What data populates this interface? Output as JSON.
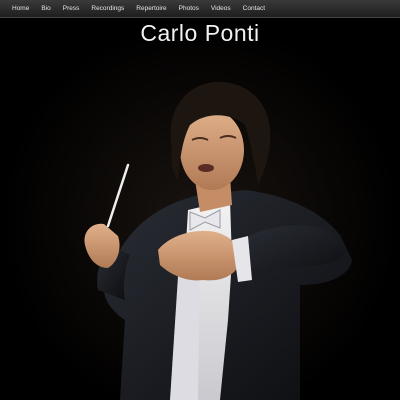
{
  "nav": {
    "items": [
      {
        "label": "Home"
      },
      {
        "label": "Bio"
      },
      {
        "label": "Press"
      },
      {
        "label": "Recordings"
      },
      {
        "label": "Repertoire"
      },
      {
        "label": "Photos"
      },
      {
        "label": "Videos"
      },
      {
        "label": "Contact"
      }
    ]
  },
  "header": {
    "title": "Carlo Ponti"
  },
  "hero": {
    "subject": "conductor-portrait"
  },
  "colors": {
    "background": "#000000",
    "nav_bg": "#2a2a2a",
    "nav_text": "#e6e6e6",
    "title_text": "#f2f2f2"
  }
}
